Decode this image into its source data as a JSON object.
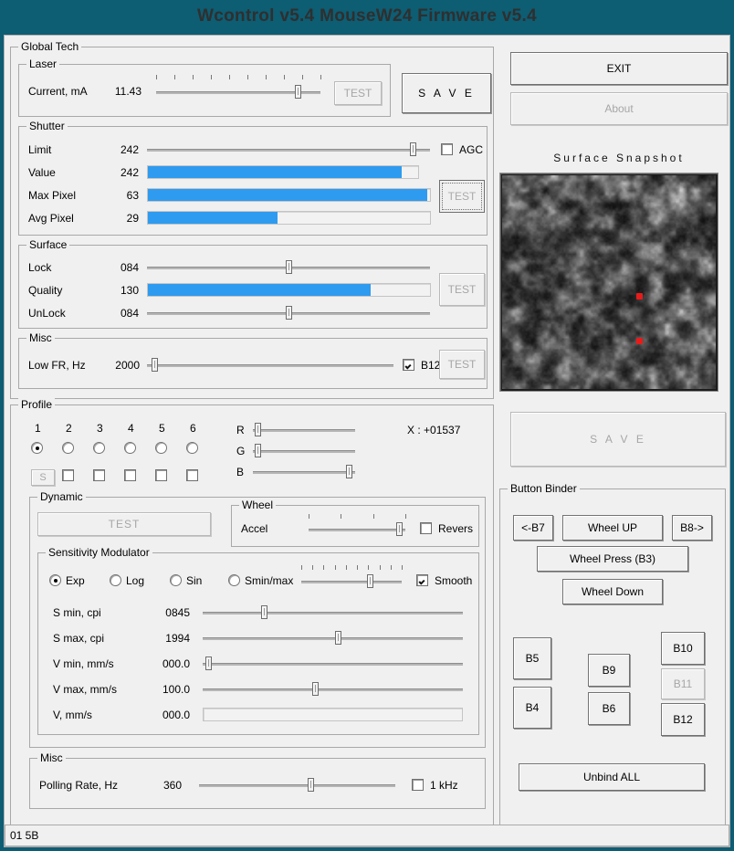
{
  "window": {
    "title": "Wcontrol v5.4  MouseW24  Firmware v5.4",
    "title_bg": "#0d5d73",
    "accent_blue": "#2e9bf0",
    "dot_red": "#e81b1b"
  },
  "global_tech": {
    "legend": "Global Tech",
    "laser": {
      "legend": "Laser",
      "label": "Current, mA",
      "value": "11.43",
      "slider_pct": 88,
      "ticks": 10,
      "test_label": "TEST",
      "test_enabled": false
    },
    "save_label": "S A V E",
    "shutter": {
      "legend": "Shutter",
      "rows": [
        {
          "label": "Limit",
          "value": "242",
          "kind": "slider",
          "pct": 95
        },
        {
          "label": "Value",
          "value": "242",
          "kind": "bar",
          "pct": 94
        },
        {
          "label": "Max Pixel",
          "value": "63",
          "kind": "bar",
          "pct": 99
        },
        {
          "label": "Avg Pixel",
          "value": "29",
          "kind": "bar",
          "pct": 46
        }
      ],
      "agc_label": "AGC",
      "agc_checked": false,
      "test_label": "TEST",
      "test_focused": true
    },
    "surface": {
      "legend": "Surface",
      "rows": [
        {
          "label": "Lock",
          "value": "084",
          "kind": "slider",
          "pct": 50
        },
        {
          "label": "Quality",
          "value": "130",
          "kind": "bar",
          "pct": 79
        },
        {
          "label": "UnLock",
          "value": "084",
          "kind": "slider",
          "pct": 50
        }
      ],
      "test_label": "TEST",
      "test_enabled": false
    },
    "misc": {
      "legend": "Misc",
      "label": "Low FR, Hz",
      "value": "2000",
      "slider_pct": 2,
      "b12_label": "B12",
      "b12_checked": true,
      "test_label": "TEST",
      "test_enabled": false
    }
  },
  "right_top": {
    "exit_label": "EXIT",
    "about_label": "About",
    "about_enabled": false,
    "snapshot_title": "Surface Snapshot"
  },
  "profile": {
    "legend": "Profile",
    "numbers": [
      "1",
      "2",
      "3",
      "4",
      "5",
      "6"
    ],
    "selected_index": 0,
    "s_label": "S",
    "s_enabled": false,
    "checkboxes": [
      false,
      false,
      false,
      false,
      false
    ],
    "rgb": [
      {
        "label": "R",
        "pct": 2
      },
      {
        "label": "G",
        "pct": 2
      },
      {
        "label": "B",
        "pct": 97
      }
    ],
    "x_readout": "X : +01537",
    "save_label": "S A V E",
    "save_enabled": false
  },
  "dynamic": {
    "legend": "Dynamic",
    "test_label": "TEST",
    "test_enabled": false,
    "wheel": {
      "legend": "Wheel",
      "label": "Accel",
      "slider_pct": 97,
      "ticks": 4,
      "revers_label": "Revers",
      "revers_checked": false
    },
    "sensitivity": {
      "legend": "Sensitivity Modulator",
      "modes": [
        "Exp",
        "Log",
        "Sin",
        "Smin/max"
      ],
      "selected_mode": 0,
      "mode_slider_pct": 70,
      "mode_ticks": 10,
      "smooth_label": "Smooth",
      "smooth_checked": true,
      "rows": [
        {
          "label": "S min, cpi",
          "value": "0845",
          "kind": "slider",
          "pct": 23
        },
        {
          "label": "S max, cpi",
          "value": "1994",
          "kind": "slider",
          "pct": 52
        },
        {
          "label": "V min, mm/s",
          "value": "000.0",
          "kind": "slider",
          "pct": 1
        },
        {
          "label": "V max, mm/s",
          "value": "100.0",
          "kind": "slider",
          "pct": 43
        },
        {
          "label": "V, mm/s",
          "value": "000.0",
          "kind": "bar",
          "pct": 0
        }
      ]
    },
    "misc": {
      "legend": "Misc",
      "label": "Polling Rate, Hz",
      "value": "360",
      "slider_pct": 57,
      "khz_label": "1 kHz",
      "khz_checked": false
    }
  },
  "button_binder": {
    "legend": "Button Binder",
    "buttons": [
      {
        "label": "<-B7",
        "enabled": true
      },
      {
        "label": "Wheel UP",
        "enabled": true
      },
      {
        "label": "B8->",
        "enabled": true
      },
      {
        "label": "Wheel Press (B3)",
        "enabled": true
      },
      {
        "label": "Wheel Down",
        "enabled": true
      },
      {
        "label": "B5",
        "enabled": true
      },
      {
        "label": "B9",
        "enabled": true
      },
      {
        "label": "B10",
        "enabled": true
      },
      {
        "label": "B4",
        "enabled": true
      },
      {
        "label": "B6",
        "enabled": true
      },
      {
        "label": "B11",
        "enabled": false
      },
      {
        "label": "B12",
        "enabled": true
      },
      {
        "label": "Unbind ALL",
        "enabled": true
      }
    ]
  },
  "status_bar": {
    "text": "01 5B"
  }
}
